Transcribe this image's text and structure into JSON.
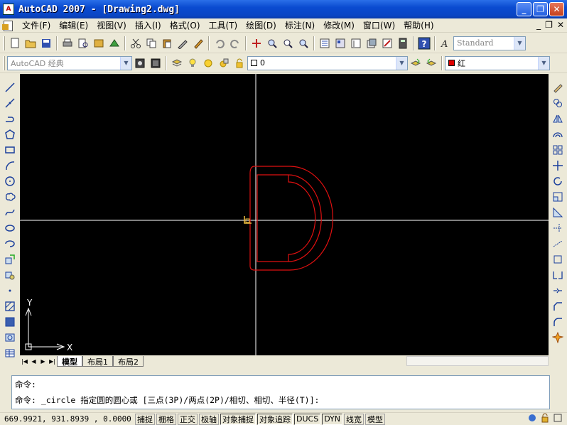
{
  "window": {
    "app_icon_text": "A",
    "title": "AutoCAD 2007 - [Drawing2.dwg]",
    "controls": {
      "minimize": "_",
      "restore": "❐",
      "close": "✕"
    }
  },
  "menubar": {
    "items": [
      "文件(F)",
      "编辑(E)",
      "视图(V)",
      "插入(I)",
      "格式(O)",
      "工具(T)",
      "绘图(D)",
      "标注(N)",
      "修改(M)",
      "窗口(W)",
      "帮助(H)"
    ],
    "doc_controls": {
      "minimize": "_",
      "restore": "❐",
      "close": "✕"
    }
  },
  "toolbar_standard": {
    "style_combo": "Standard"
  },
  "toolbar_layers": {
    "workspace_combo": "AutoCAD 经典",
    "layer_combo": "0",
    "color_combo": "红"
  },
  "drawing": {
    "background": "#000000",
    "crosshair_color": "#ffffff",
    "geometry_color": "#e01010",
    "ucs_x_label": "X",
    "ucs_y_label": "Y"
  },
  "layout_tabs": {
    "tabs": [
      "模型",
      "布局1",
      "布局2"
    ],
    "active": "模型",
    "nav": [
      "|◀",
      "◀",
      "▶",
      "▶|"
    ]
  },
  "command": {
    "line1": "命令:",
    "line2": "命令: _circle 指定圆的圆心或 [三点(3P)/两点(2P)/相切、相切、半径(T)]:"
  },
  "statusbar": {
    "coordinates": "669.9921,  931.8939 , 0.0000",
    "toggles": [
      "捕捉",
      "栅格",
      "正交",
      "极轴",
      "对象捕捉",
      "对象追踪",
      "DUCS",
      "DYN",
      "线宽",
      "模型"
    ]
  }
}
